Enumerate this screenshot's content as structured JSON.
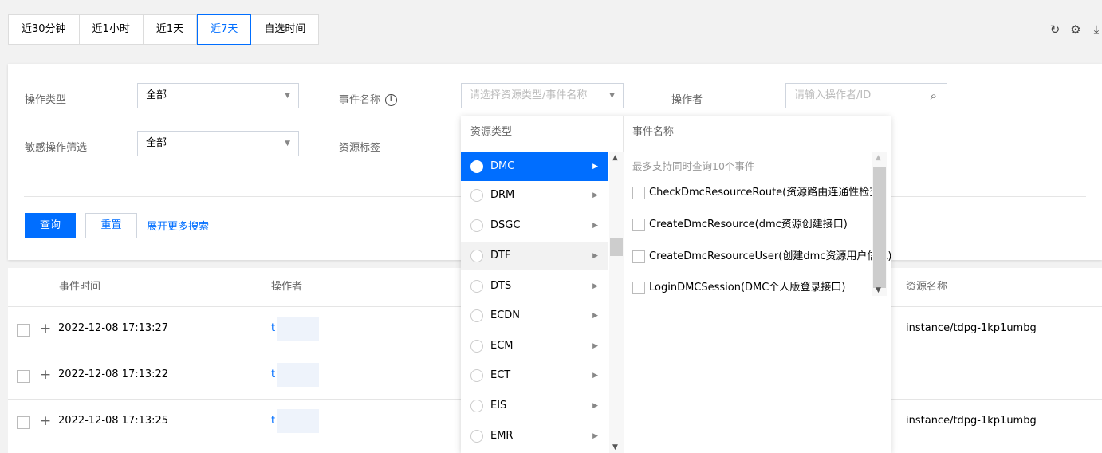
{
  "time_tabs": [
    {
      "label": "近30分钟",
      "active": false
    },
    {
      "label": "近1小时",
      "active": false
    },
    {
      "label": "近1天",
      "active": false
    },
    {
      "label": "近7天",
      "active": true
    },
    {
      "label": "自选时间",
      "active": false
    }
  ],
  "top_icons": [
    "refresh-icon",
    "settings-icon",
    "download-icon"
  ],
  "filters": {
    "operation_type": {
      "label": "操作类型",
      "value": "全部"
    },
    "sensitive_filter": {
      "label": "敏感操作筛选",
      "value": "全部"
    },
    "event_name": {
      "label": "事件名称",
      "placeholder": "请选择资源类型/事件名称"
    },
    "resource_tag": {
      "label": "资源标签"
    },
    "operator": {
      "label": "操作者",
      "placeholder": "请输入操作者/ID"
    }
  },
  "actions": {
    "query": "查询",
    "reset": "重置",
    "more": "展开更多搜索"
  },
  "table": {
    "headers": {
      "event_time": "事件时间",
      "operator": "操作者",
      "resource_name": "资源名称"
    },
    "rows": [
      {
        "time": "2022-12-08 17:13:27",
        "operator": "t",
        "resource": "instance/tdpg-1kp1umbg"
      },
      {
        "time": "2022-12-08 17:13:22",
        "operator": "t",
        "resource": ""
      },
      {
        "time": "2022-12-08 17:13:25",
        "operator": "t",
        "resource": "instance/tdpg-1kp1umbg"
      }
    ]
  },
  "cascader": {
    "resource_type_header": "资源类型",
    "event_name_header": "事件名称",
    "note": "最多支持同时查询10个事件",
    "resource_types": [
      "DMC",
      "DRM",
      "DSGC",
      "DTF",
      "DTS",
      "ECDN",
      "ECM",
      "ECT",
      "EIS",
      "EMR"
    ],
    "selected_type": "DMC",
    "hovered_type": "DTF",
    "events": [
      "CheckDmcResourceRoute(资源路由连通性检查)",
      "CreateDmcResource(dmc资源创建接口)",
      "CreateDmcResourceUser(创建dmc资源用户信息)",
      "LoginDMCSession(DMC个人版登录接口)"
    ]
  },
  "colors": {
    "accent": "#006eff",
    "background": "#f2f2f2"
  }
}
